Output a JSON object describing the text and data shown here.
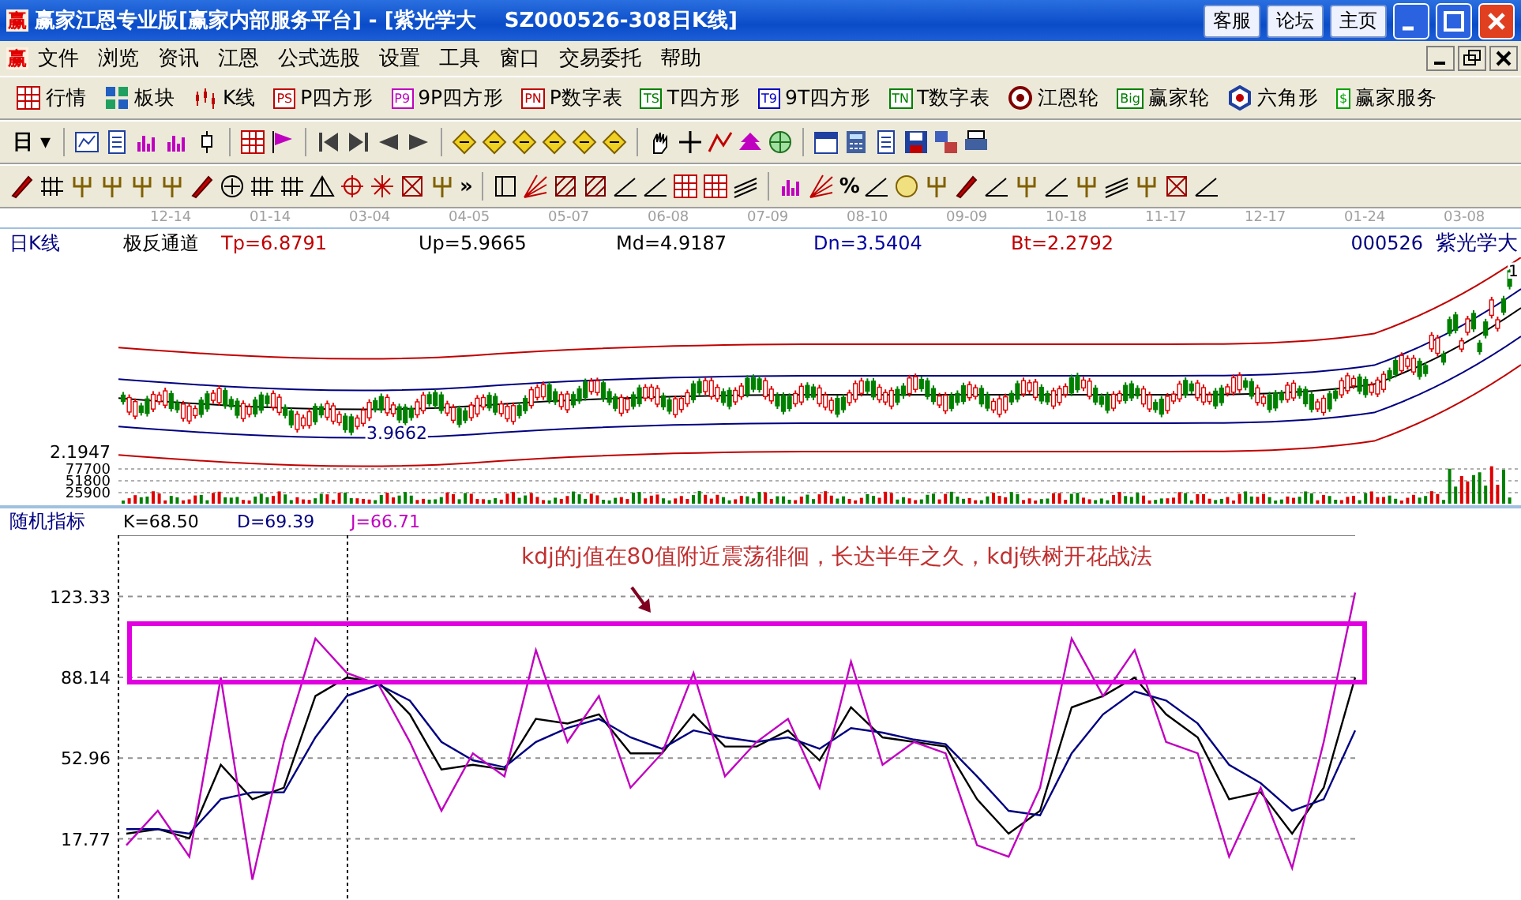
{
  "window": {
    "icon": "赢",
    "title": "赢家江恩专业版[赢家内部服务平台] - [紫光学大    SZ000526-308日K线]",
    "links": [
      "客服",
      "论坛",
      "主页"
    ]
  },
  "menu": {
    "icon": "赢",
    "items": [
      "文件",
      "浏览",
      "资讯",
      "江恩",
      "公式选股",
      "设置",
      "工具",
      "窗口",
      "交易委托",
      "帮助"
    ]
  },
  "toolbar": [
    {
      "kind": "grid",
      "label": "行情"
    },
    {
      "kind": "blocks",
      "label": "板块"
    },
    {
      "kind": "candles",
      "label": "K线"
    },
    {
      "kind": "badge",
      "badge": "PS",
      "color": "#c00000",
      "label": "P四方形"
    },
    {
      "kind": "badge",
      "badge": "P9",
      "color": "#c000c0",
      "label": "9P四方形"
    },
    {
      "kind": "badge",
      "badge": "PN",
      "color": "#c00000",
      "label": "P数字表"
    },
    {
      "kind": "badge",
      "badge": "TS",
      "color": "#008000",
      "label": "T四方形"
    },
    {
      "kind": "badge",
      "badge": "T9",
      "color": "#0000c0",
      "label": "9T四方形"
    },
    {
      "kind": "badge",
      "badge": "TN",
      "color": "#008000",
      "label": "T数字表"
    },
    {
      "kind": "wheel",
      "label": "江恩轮"
    },
    {
      "kind": "badge",
      "badge": "Big",
      "color": "#008000",
      "label": "赢家轮"
    },
    {
      "kind": "hexagon",
      "label": "六角形"
    },
    {
      "kind": "badge",
      "badge": "$",
      "color": "#00a000",
      "label": "赢家服务"
    }
  ],
  "toolbar2": {
    "dropdown": "日",
    "caret": "▾"
  },
  "toolbar3": {
    "overflow": "»",
    "percent": "%"
  },
  "date_axis": [
    "12-14",
    "01-14",
    "03-04",
    "04-05",
    "05-07",
    "06-08",
    "07-09",
    "08-10",
    "09-09",
    "10-18",
    "11-17",
    "12-17",
    "01-24",
    "03-08"
  ],
  "price_panel": {
    "label": "日K线",
    "indicator": "极反通道",
    "values": [
      {
        "text": "Tp=6.8791",
        "color": "#c00000"
      },
      {
        "text": "Up=5.9665",
        "color": "#000000"
      },
      {
        "text": "Md=4.9187",
        "color": "#000000"
      },
      {
        "text": "Dn=3.5404",
        "color": "#0000a0"
      },
      {
        "text": "Bt=2.2792",
        "color": "#c00000"
      }
    ],
    "code": "000526",
    "name": "紫光学大",
    "high_label": "1",
    "low_label": "3.9662",
    "price_tick": "2.1947",
    "volume_ticks": [
      "77700",
      "51800",
      "25900"
    ]
  },
  "kdj_panel": {
    "label": "随机指标",
    "chart_data": {
      "type": "line",
      "grid": true,
      "ylim": [
        -13,
        150
      ],
      "yticks": [
        17.77,
        52.96,
        88.14,
        123.33
      ],
      "series": [
        {
          "name": "K=68.50",
          "color": "#000000",
          "values": [
            20,
            22,
            18,
            50,
            35,
            40,
            80,
            88,
            86,
            72,
            48,
            50,
            48,
            70,
            68,
            72,
            55,
            55,
            72,
            58,
            58,
            65,
            52,
            75,
            62,
            60,
            58,
            35,
            20,
            30,
            75,
            80,
            88,
            72,
            62,
            35,
            38,
            20,
            40,
            88
          ]
        },
        {
          "name": "D=69.39",
          "color": "#000080",
          "values": [
            22,
            22,
            20,
            35,
            38,
            38,
            62,
            80,
            85,
            78,
            60,
            52,
            49,
            60,
            66,
            70,
            62,
            57,
            65,
            62,
            60,
            62,
            57,
            66,
            64,
            61,
            59,
            45,
            30,
            28,
            55,
            72,
            82,
            78,
            68,
            50,
            42,
            30,
            35,
            65
          ]
        },
        {
          "name": "J=66.71",
          "color": "#c000c0",
          "values": [
            15,
            30,
            10,
            88,
            0,
            60,
            105,
            90,
            85,
            60,
            30,
            55,
            45,
            100,
            60,
            80,
            40,
            55,
            90,
            45,
            60,
            70,
            40,
            95,
            50,
            60,
            55,
            15,
            10,
            40,
            105,
            80,
            100,
            60,
            55,
            10,
            40,
            5,
            60,
            125
          ]
        }
      ],
      "annotations": [
        {
          "text": "kdj的j值在80值附近震荡徘徊，长达半年之久，kdj铁树开花战法"
        }
      ]
    }
  }
}
